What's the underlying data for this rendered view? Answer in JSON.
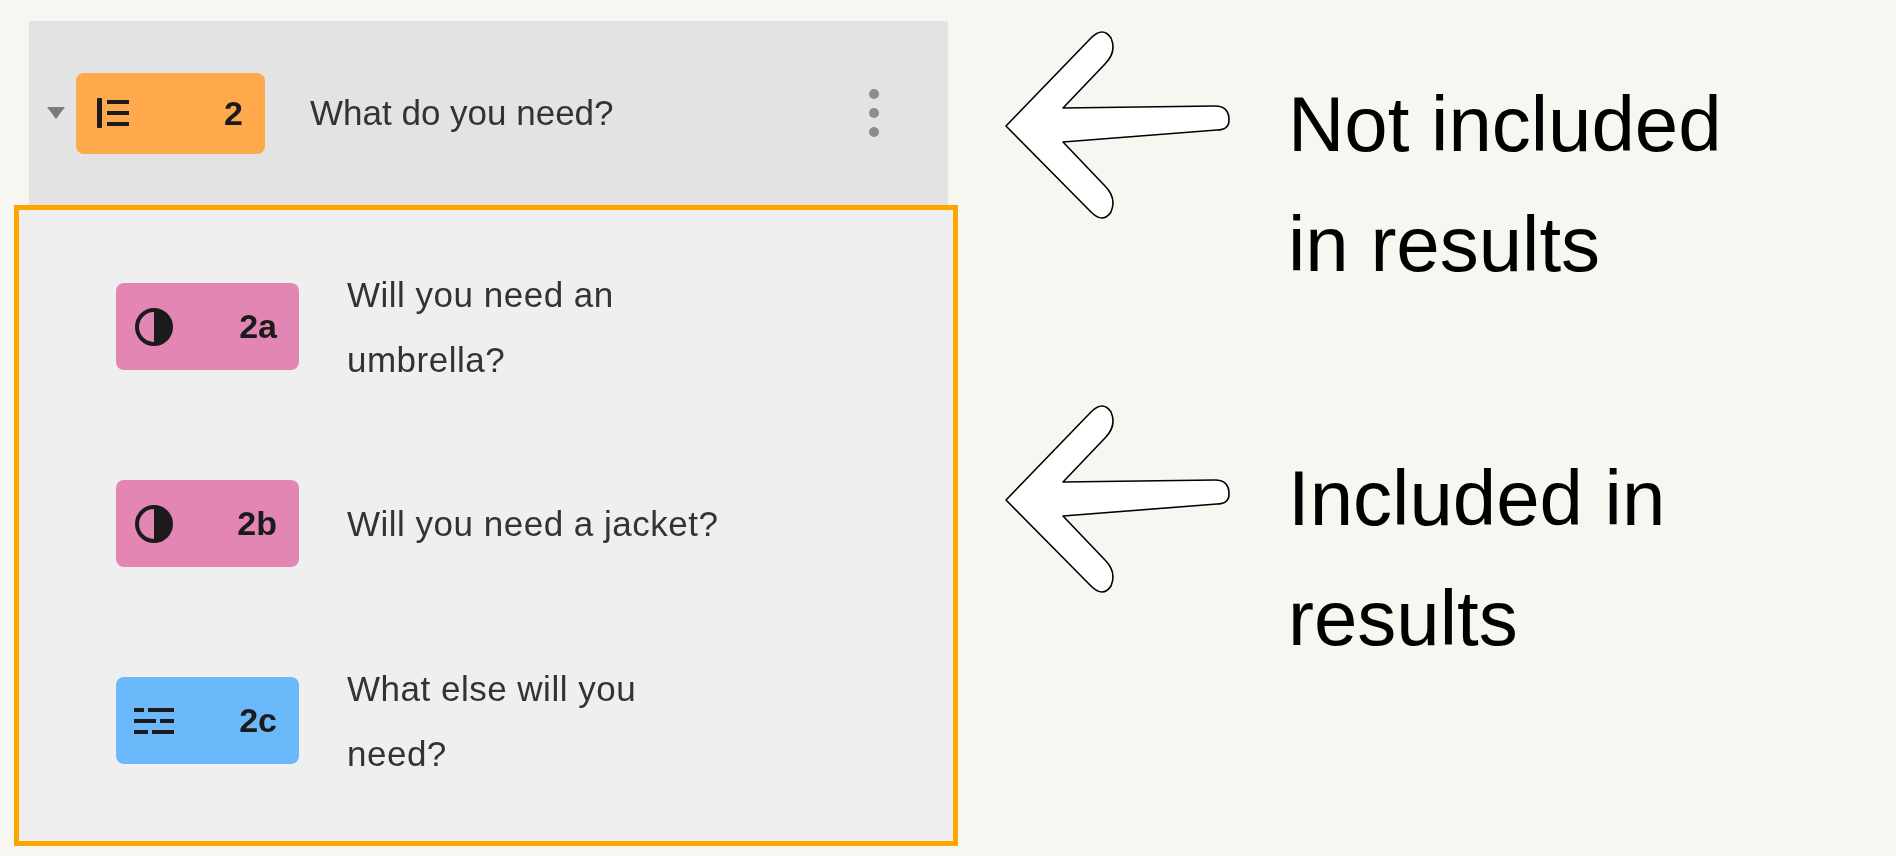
{
  "question": {
    "number": "2",
    "title": "What do you need?",
    "kind": "group",
    "color": "#ffa94d",
    "expanded": true
  },
  "children": [
    {
      "number": "2a",
      "title": "Will you need an umbrella?",
      "kind": "yes_no",
      "color": "#e386b4"
    },
    {
      "number": "2b",
      "title": "Will you need a jacket?",
      "kind": "yes_no",
      "color": "#e386b4"
    },
    {
      "number": "2c",
      "title": "What else will you need?",
      "kind": "short_text",
      "color": "#6bb9fb"
    }
  ],
  "annotations": [
    {
      "text": "Not included in results"
    },
    {
      "text": "Included in results"
    }
  ]
}
